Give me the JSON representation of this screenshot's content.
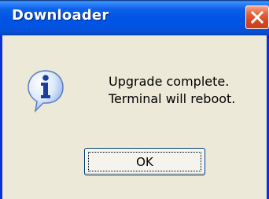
{
  "window": {
    "title": "Downloader"
  },
  "titlebar": {
    "close_icon": "close-icon"
  },
  "dialog": {
    "icon": "information-icon",
    "message_line1": "Upgrade complete.",
    "message_line2": "Terminal will reboot.",
    "ok_label": "OK"
  },
  "colors": {
    "titlebar_blue": "#0054e3",
    "close_red": "#d44521",
    "face": "#ece9d8",
    "border_blue": "#0831d9"
  }
}
